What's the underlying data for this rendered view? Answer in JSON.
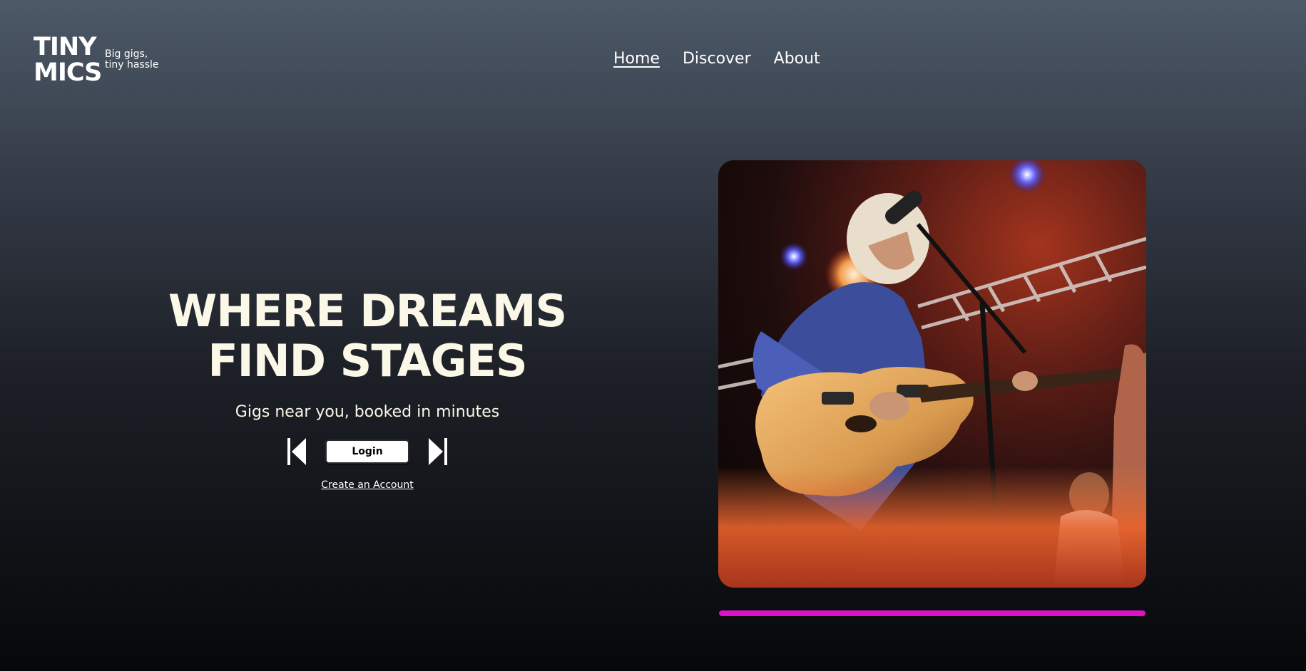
{
  "brand": {
    "line1": "TINY",
    "line2": "MICS",
    "tagline_line1": "Big gigs,",
    "tagline_line2": "tiny hassle"
  },
  "nav": {
    "items": [
      {
        "label": "Home",
        "active": true
      },
      {
        "label": "Discover",
        "active": false
      },
      {
        "label": "About",
        "active": false
      }
    ]
  },
  "hero": {
    "title_line1": "WHERE DREAMS",
    "title_line2": "FIND STAGES",
    "subtitle": "Gigs near you, booked in minutes",
    "login_label": "Login",
    "create_account_label": "Create an Account",
    "prev_icon": "skip-previous-icon",
    "next_icon": "skip-next-icon"
  },
  "carousel": {
    "image_alt": "guitarist-performing-on-stage",
    "progress": 1.0,
    "progress_color": "#de10c8"
  },
  "colors": {
    "title": "#fbf8e8",
    "accent": "#de10c8"
  }
}
